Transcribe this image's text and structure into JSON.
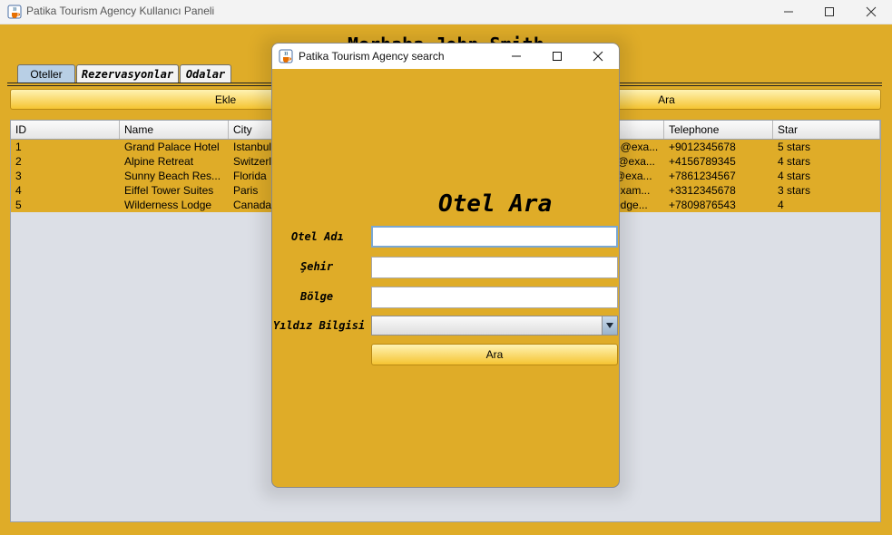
{
  "window": {
    "title": "Patika Tourism Agency Kullanıcı Paneli",
    "icon": "java-cup-icon"
  },
  "main": {
    "greeting": "Merhaba John Smith",
    "tabs": [
      {
        "label": "Oteller",
        "active": true
      },
      {
        "label": "Rezervasyonlar",
        "active": false
      },
      {
        "label": "Odalar",
        "active": false
      }
    ],
    "add_button_label": "Ekle",
    "search_button_label": "Ara",
    "table": {
      "columns": [
        "ID",
        "Name",
        "City",
        "",
        "",
        "",
        "Telephone",
        "Star"
      ],
      "rows": [
        [
          "1",
          "Grand Palace Hotel",
          "Istanbul",
          "",
          "",
          "e@exa...",
          "+9012345678",
          "5 stars"
        ],
        [
          "2",
          "Alpine Retreat",
          "Switzerland",
          "",
          "",
          "t@exa...",
          "+4156789345",
          "4 stars"
        ],
        [
          "3",
          "Sunny Beach Res...",
          "Florida",
          "",
          "",
          "@exa...",
          "+7861234567",
          "4 stars"
        ],
        [
          "4",
          "Eiffel Tower Suites",
          "Paris",
          "",
          "",
          "exam...",
          "+3312345678",
          "3 stars"
        ],
        [
          "5",
          "Wilderness Lodge",
          "Canada",
          "",
          "",
          "odge...",
          "+7809876543",
          "4"
        ]
      ]
    }
  },
  "dialog": {
    "title": "Patika Tourism Agency search",
    "heading": "Otel Ara",
    "fields": {
      "hotel_name_label": "Otel Adı",
      "hotel_name_value": "",
      "city_label": "Şehir",
      "city_value": "",
      "region_label": "Bölge",
      "region_value": "",
      "star_label": "Yıldız Bilgisi",
      "star_selected": ""
    },
    "search_button_label": "Ara"
  },
  "colors": {
    "panel_background": "#dfac28",
    "button_gradient_top": "#fff3b4",
    "button_gradient_bottom": "#f5c431",
    "active_tab": "#b8cfe5",
    "table_empty_area": "#dcdfe6"
  }
}
